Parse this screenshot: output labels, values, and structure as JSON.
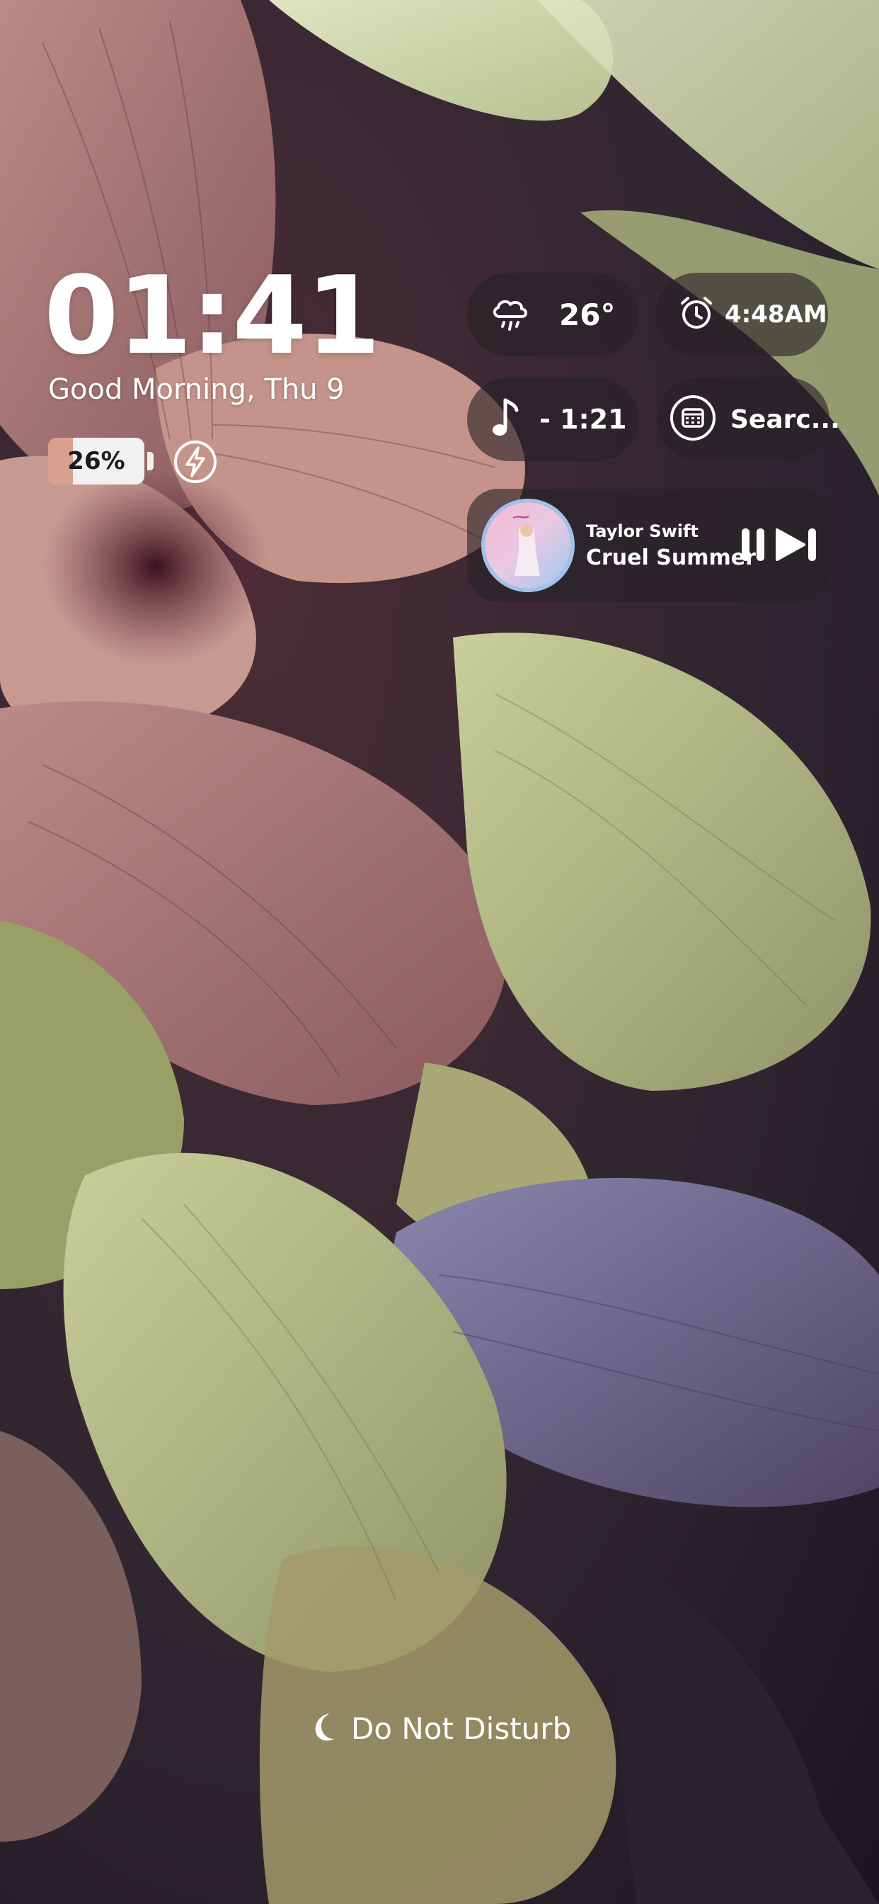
{
  "clock": {
    "time": "01:41",
    "greeting": "Good Morning, Thu 9"
  },
  "battery": {
    "percent_label": "26%",
    "level": 0.26,
    "charging_icon": "lightning-bolt-icon"
  },
  "widgets": {
    "weather": {
      "value": "26°",
      "icon": "rain-cloud-icon"
    },
    "alarm": {
      "value": "4:48AM",
      "icon": "alarm-clock-icon"
    },
    "music_timer": {
      "value": "- 1:21",
      "icon": "music-note-icon"
    },
    "calendar": {
      "value": "Searc...",
      "icon": "calendar-icon"
    }
  },
  "now_playing": {
    "artist": "Taylor Swift",
    "track": "Cruel Summer",
    "controls": [
      "pause-icon",
      "next-track-icon"
    ]
  },
  "status": {
    "dnd_label": "Do Not Disturb",
    "dnd_icon": "moon-icon"
  },
  "colors": {
    "pill_background": "rgba(40,34,38,0.62)",
    "battery_fill": "#d8a08f",
    "album_ring": "#9fc3f0"
  }
}
